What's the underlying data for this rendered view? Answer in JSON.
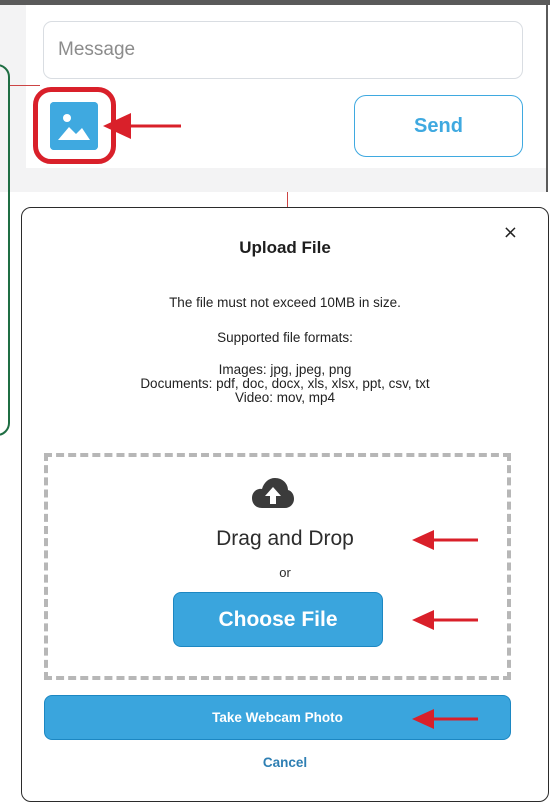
{
  "composer": {
    "message_placeholder": "Message",
    "send_label": "Send",
    "image_button_icon": "image-icon"
  },
  "modal": {
    "title": "Upload File",
    "close_label": "×",
    "size_notice": "The file must not exceed 10MB in size.",
    "formats_title": "Supported file formats:",
    "formats_images": "Images: jpg, jpeg, png",
    "formats_documents": "Documents: pdf, doc, docx, xls, xlsx, ppt, csv, txt",
    "formats_video": "Video: mov, mp4",
    "drag_drop_label": "Drag and Drop",
    "or_label": "or",
    "choose_file_label": "Choose File",
    "webcam_label": "Take Webcam Photo",
    "cancel_label": "Cancel"
  },
  "colors": {
    "accent": "#3aa5dd",
    "highlight": "#d9202a",
    "cancel_link": "#2e7fb3"
  }
}
